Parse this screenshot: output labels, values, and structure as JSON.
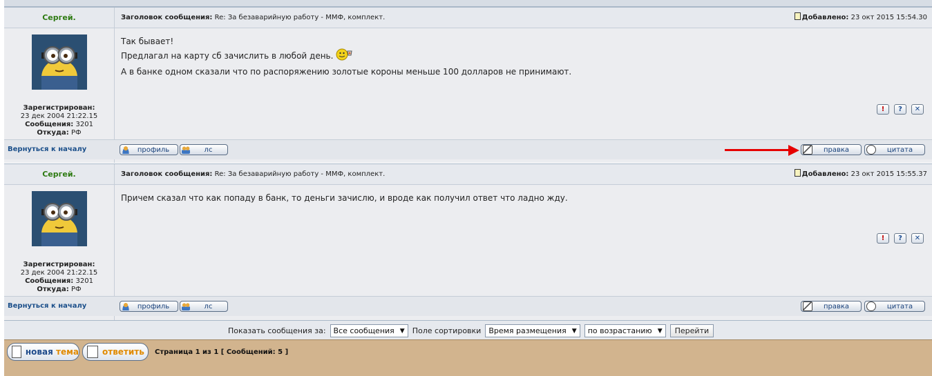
{
  "posts": [
    {
      "author": "Сергей.",
      "subject_label": "Заголовок сообщения:",
      "subject": "Re: За безаварийную работу - ММФ, комплект.",
      "added_label": "Добавлено:",
      "added": "23 окт 2015 15:54.30",
      "registered_label": "Зарегистрирован:",
      "registered": "23 дек 2004 21:22.15",
      "messages_label": "Сообщения:",
      "messages": "3201",
      "from_label": "Откуда:",
      "from": "РФ",
      "body": [
        "Так бывает!",
        "Предлагал на карту сб зачислить в любой день.",
        "А в банке одном сказали что по распоряжению золотые короны меньше 100 долларов не принимают."
      ],
      "back_label": "Вернуться к началу",
      "profile_label": "профиль",
      "pm_label": "лс",
      "edit_label": "правка",
      "quote_label": "цитата"
    },
    {
      "author": "Сергей.",
      "subject_label": "Заголовок сообщения:",
      "subject": "Re: За безаварийную работу - ММФ, комплект.",
      "added_label": "Добавлено:",
      "added": "23 окт 2015 15:55.37",
      "registered_label": "Зарегистрирован:",
      "registered": "23 дек 2004 21:22.15",
      "messages_label": "Сообщения:",
      "messages": "3201",
      "from_label": "Откуда:",
      "from": "РФ",
      "body": [
        "Причем сказал что как попаду в банк, то деньги зачислю, и вроде как получил ответ что ладно жду."
      ],
      "back_label": "Вернуться к началу",
      "profile_label": "профиль",
      "pm_label": "лс",
      "edit_label": "правка",
      "quote_label": "цитата"
    }
  ],
  "sort": {
    "show_label": "Показать сообщения за:",
    "show_value": "Все сообщения",
    "sort_label": "Поле сортировки",
    "sort_value": "Время размещения",
    "order_value": "по возрастанию",
    "go_label": "Перейти"
  },
  "bottom": {
    "new_topic_a": "новая",
    "new_topic_b": "тема",
    "reply_label": "ответить",
    "pagination": "Страница 1 из 1 [ Сообщений: 5 ]"
  },
  "icons": {
    "report": "!",
    "info": "?",
    "delete": "✕"
  }
}
